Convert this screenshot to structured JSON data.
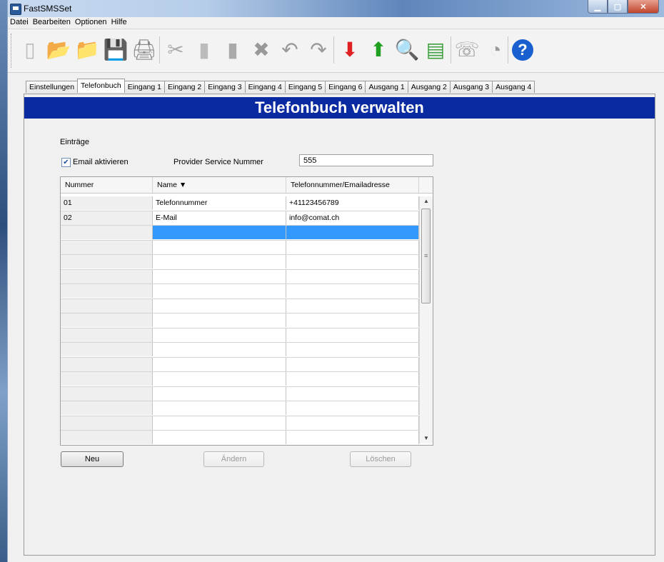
{
  "window": {
    "title": "FastSMSSet"
  },
  "menu": [
    "Datei",
    "Bearbeiten",
    "Optionen",
    "Hilfe"
  ],
  "toolbar": [
    {
      "name": "new-file-icon",
      "glyph": "▯",
      "color": "#bbbbbb"
    },
    {
      "name": "open-folder-icon",
      "glyph": "📂",
      "color": "#e8a000"
    },
    {
      "name": "folder-up-icon",
      "glyph": "📁",
      "color": "#e89000"
    },
    {
      "name": "save-icon",
      "glyph": "💾",
      "color": "#1a5fb4"
    },
    {
      "name": "print-icon",
      "glyph": "🖨",
      "color": "#888888"
    },
    {
      "name": "cut-icon",
      "glyph": "✂",
      "color": "#aaaaaa"
    },
    {
      "name": "copy-icon",
      "glyph": "▮",
      "color": "#bbbbbb"
    },
    {
      "name": "paste-icon",
      "glyph": "▮",
      "color": "#aaaaaa"
    },
    {
      "name": "delete-icon",
      "glyph": "✖",
      "color": "#999999"
    },
    {
      "name": "undo-icon",
      "glyph": "↶",
      "color": "#999999"
    },
    {
      "name": "redo-icon",
      "glyph": "↷",
      "color": "#999999"
    },
    {
      "name": "download-arrow-icon",
      "glyph": "⬇",
      "color": "#e02020"
    },
    {
      "name": "upload-arrow-icon",
      "glyph": "⬆",
      "color": "#20a020"
    },
    {
      "name": "search-icon",
      "glyph": "🔍",
      "color": "#888888"
    },
    {
      "name": "device-icon",
      "glyph": "▤",
      "color": "#40a040"
    },
    {
      "name": "phone-icon",
      "glyph": "☏",
      "color": "#999999"
    },
    {
      "name": "call-icon",
      "glyph": "◔",
      "color": "#999999"
    },
    {
      "name": "help-icon",
      "glyph": "?",
      "color": "#1a5fd0"
    }
  ],
  "tabs": [
    "Einstellungen",
    "Telefonbuch",
    "Eingang 1",
    "Eingang 2",
    "Eingang 3",
    "Eingang 4",
    "Eingang 5",
    "Eingang 6",
    "Ausgang 1",
    "Ausgang 2",
    "Ausgang 3",
    "Ausgang 4"
  ],
  "active_tab": "Telefonbuch",
  "panel": {
    "banner": "Telefonbuch verwalten",
    "section_label": "Einträge",
    "email_checkbox_label": "Email aktivieren",
    "email_checked": true,
    "provider_label": "Provider Service Nummer",
    "provider_value": "555"
  },
  "table": {
    "headers": [
      "Nummer",
      "Name ▼",
      "Telefonnummer/Emailadresse"
    ],
    "rows": [
      [
        "01",
        "Telefonnummer",
        "+41123456789"
      ],
      [
        "02",
        "E-Mail",
        "info@comat.ch"
      ],
      [
        "",
        "",
        ""
      ],
      [
        "",
        "",
        ""
      ],
      [
        "",
        "",
        ""
      ],
      [
        "",
        "",
        ""
      ],
      [
        "",
        "",
        ""
      ],
      [
        "",
        "",
        ""
      ],
      [
        "",
        "",
        ""
      ],
      [
        "",
        "",
        ""
      ],
      [
        "",
        "",
        ""
      ],
      [
        "",
        "",
        ""
      ],
      [
        "",
        "",
        ""
      ],
      [
        "",
        "",
        ""
      ],
      [
        "",
        "",
        ""
      ],
      [
        "",
        "",
        ""
      ],
      [
        "",
        "",
        ""
      ],
      [
        "",
        "",
        ""
      ]
    ],
    "selected_row": 2
  },
  "buttons": {
    "new": "Neu",
    "edit": "Ändern",
    "delete": "Löschen"
  }
}
